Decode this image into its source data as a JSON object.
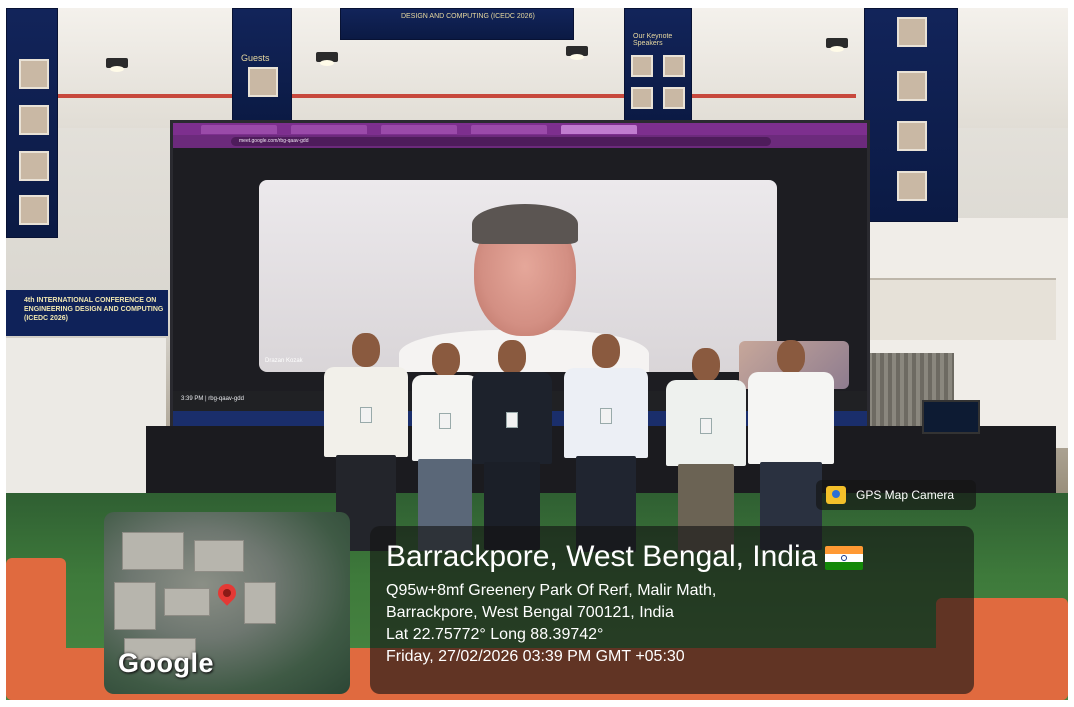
{
  "photo": {
    "subject": "conference-group-photo"
  },
  "screen": {
    "participant_name": "Drazan Kozak",
    "meeting_time": "3:39 PM | rbg-qaav-gdd",
    "url": "meet.google.com/rbg-qaav-gdd"
  },
  "banner_top": {
    "text": "DESIGN AND COMPUTING (ICEDC 2026)"
  },
  "banner_left": {
    "text": "4th INTERNATIONAL CONFERENCE ON ENGINEERING DESIGN AND COMPUTING (ICEDC 2026)"
  },
  "banner_keynote": {
    "title": "Our Keynote Speakers"
  },
  "banner_guests": {
    "title": "Guests"
  },
  "gps_badge": {
    "label": "GPS Map Camera"
  },
  "map": {
    "brand": "Google"
  },
  "location": {
    "title": "Barrackpore, West Bengal, India",
    "address_line1": "Q95w+8mf Greenery Park Of Rerf, Malir Math,",
    "address_line2": "Barrackpore, West Bengal 700121, India",
    "coords": "Lat 22.75772° Long 88.39742°",
    "datetime": "Friday, 27/02/2026 03:39 PM GMT +05:30"
  },
  "colors": {
    "carpet": "#3e7a3b",
    "sofa": "#e06a3f",
    "banner": "#12245a",
    "browser": "#7d2f8e"
  }
}
